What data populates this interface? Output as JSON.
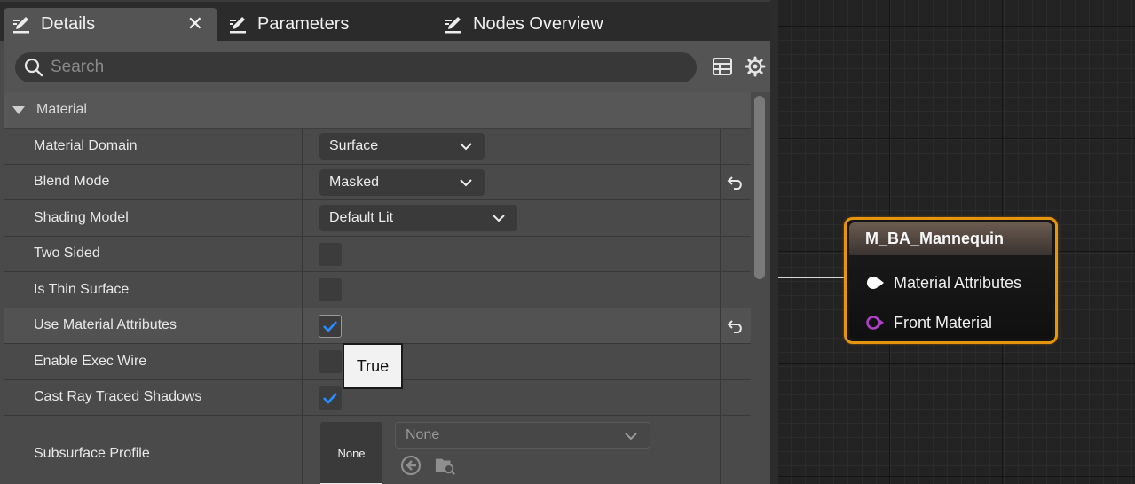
{
  "tabs": [
    {
      "label": "Details",
      "icon": "pencil-icon",
      "active": true
    },
    {
      "label": "Parameters",
      "icon": "pencil-icon",
      "active": false
    },
    {
      "label": "Nodes Overview",
      "icon": "pencil-icon",
      "active": false
    }
  ],
  "close_glyph": "✕",
  "search": {
    "placeholder": "Search",
    "value": ""
  },
  "toolbar": {
    "icons": [
      "table-view-icon",
      "settings-gear-icon"
    ]
  },
  "section": {
    "title": "Material",
    "expanded": true
  },
  "properties": [
    {
      "label": "Material Domain",
      "type": "combo",
      "value": "Surface",
      "modified": false
    },
    {
      "label": "Blend Mode",
      "type": "combo",
      "value": "Masked",
      "modified": true
    },
    {
      "label": "Shading Model",
      "type": "combo",
      "value": "Default Lit",
      "modified": false
    },
    {
      "label": "Two Sided",
      "type": "checkbox",
      "checked": false,
      "modified": false
    },
    {
      "label": "Is Thin Surface",
      "type": "checkbox",
      "checked": false,
      "modified": false
    },
    {
      "label": "Use Material Attributes",
      "type": "checkbox",
      "checked": true,
      "modified": true,
      "hovered": true
    },
    {
      "label": "Enable Exec Wire",
      "type": "checkbox",
      "checked": false,
      "modified": false
    },
    {
      "label": "Cast Ray Traced Shadows",
      "type": "checkbox",
      "checked": true,
      "modified": false
    },
    {
      "label": "Subsurface Profile",
      "type": "asset",
      "thumbnail_label": "None",
      "value": "None"
    }
  ],
  "tooltip": {
    "text": "True"
  },
  "node": {
    "title": "M_BA_Mannequin",
    "pins": [
      {
        "label": "Material Attributes",
        "color": "#ffffff"
      },
      {
        "label": "Front Material",
        "color": "#b040c8"
      }
    ],
    "border_color": "#e6950e"
  },
  "colors": {
    "panel_bg": "#4a4a4a",
    "graph_bg": "#232323",
    "check_accent": "#2a8cff"
  }
}
